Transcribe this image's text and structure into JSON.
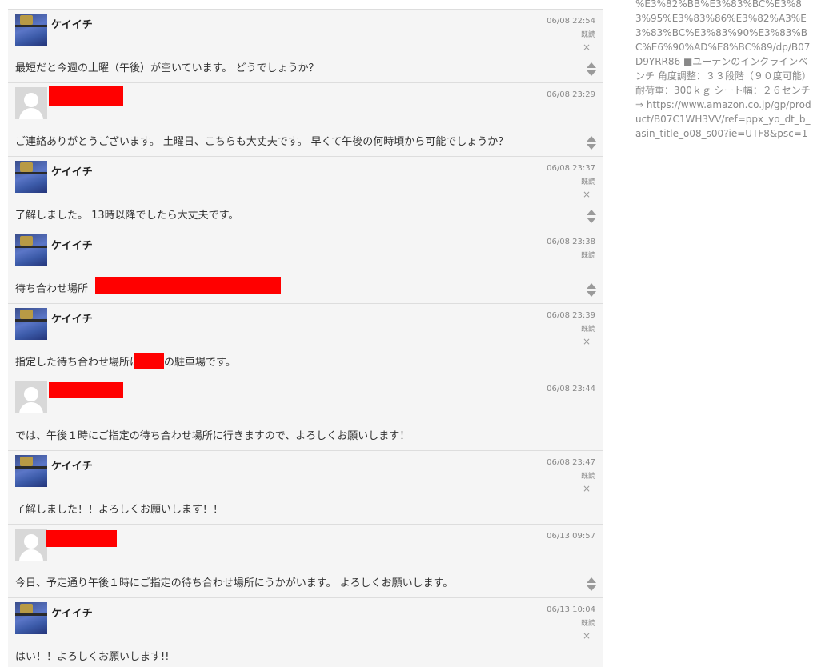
{
  "thread": {
    "messages": [
      {
        "kind": "self",
        "name": "ケイイチ",
        "time": "06/08 22:54",
        "read": "既読",
        "close": "×",
        "text": "最短だと今週の土曜（午後）が空いています。 どうでしょうか？",
        "sort": true
      },
      {
        "kind": "other",
        "name": "",
        "time": "06/08 23:29",
        "read": "",
        "close": "",
        "text": "ご連絡ありがとうございます。 土曜日、こちらも大丈夫です。 早くて午後の何時頃から可能でしょうか？",
        "sort": true
      },
      {
        "kind": "self",
        "name": "ケイイチ",
        "time": "06/08 23:37",
        "read": "既読",
        "close": "×",
        "text": "了解しました。 13時以降でしたら大丈夫です。",
        "sort": true
      },
      {
        "kind": "self",
        "name": "ケイイチ",
        "time": "06/08 23:38",
        "read": "既読",
        "close": "",
        "text": "待ち合わせ場所",
        "sort": true
      },
      {
        "kind": "self",
        "name": "ケイイチ",
        "time": "06/08 23:39",
        "read": "既読",
        "close": "×",
        "text": "指定した待ち合わせ場所は",
        "text_after": "の駐車場です。",
        "sort": false
      },
      {
        "kind": "other",
        "name": "",
        "time": "06/08 23:44",
        "read": "",
        "close": "",
        "text": "では、午後１時にご指定の待ち合わせ場所に行きますので、よろしくお願いします！",
        "sort": false
      },
      {
        "kind": "self",
        "name": "ケイイチ",
        "time": "06/08 23:47",
        "read": "既読",
        "close": "×",
        "text": "了解しました！！よろしくお願いします！！",
        "sort": false
      },
      {
        "kind": "other",
        "name": "",
        "time": "06/13 09:57",
        "read": "",
        "close": "",
        "text": "今日、予定通り午後１時にご指定の待ち合わせ場所にうかがいます。 よろしくお願いします。",
        "sort": true
      },
      {
        "kind": "self",
        "name": "ケイイチ",
        "time": "06/13 10:04",
        "read": "既読",
        "close": "×",
        "text": "はい！！よろしくお願いします!!",
        "sort": false
      }
    ]
  },
  "sidebar": {
    "text": "%E3%82%BB%E3%83%BC%E3%83%95%E3%83%86%E3%82%A3%E3%83%BC%E3%83%90%E3%83%BC%E6%90%AD%E8%BC%89/dp/B07D9YRR86 ■ユーテンのインクラインベンチ 角度調整：３３段階（９０度可能） 耐荷重：300ｋｇ シート幅：２６センチ ⇒ https://www.amazon.co.jp/gp/product/B07C1WH3VV/ref=ppx_yo_dt_b_asin_title_o08_s00?ie=UTF8&psc=1"
  },
  "colors": {
    "redaction": "#ff0000",
    "message_bg": "#f5f5f5",
    "divider": "#dddddd"
  }
}
